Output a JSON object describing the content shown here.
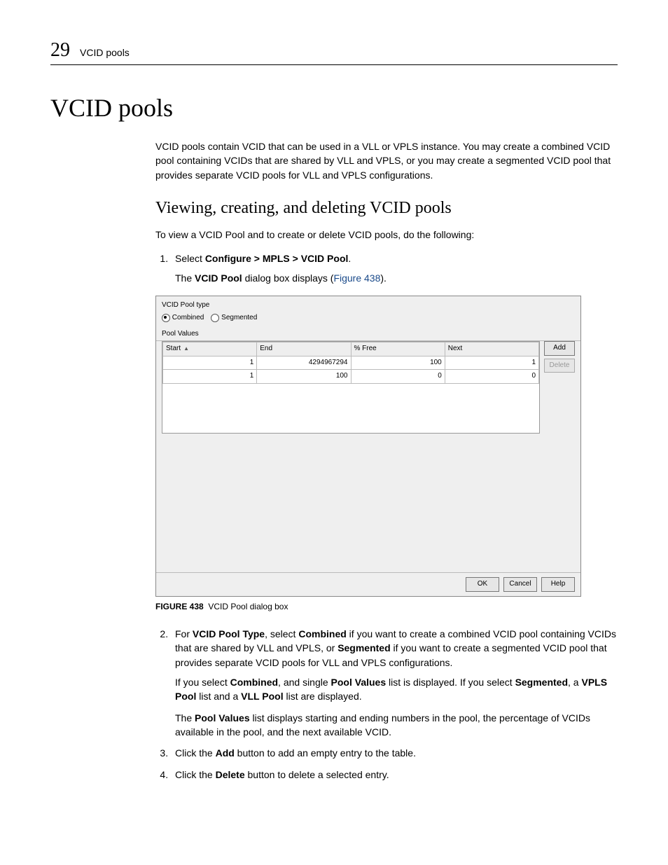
{
  "header": {
    "chapter_number": "29",
    "running_title": "VCID pools"
  },
  "h1": "VCID pools",
  "intro": "VCID pools contain VCID that can be used in a VLL or VPLS instance. You may create a combined VCID pool containing VCIDs that are shared by VLL and VPLS, or you may create a segmented VCID pool that provides separate VCID pools for VLL and VPLS configurations.",
  "h2": "Viewing, creating, and deleting VCID pools",
  "lead": "To view a VCID Pool and to create or delete VCID pools, do the following:",
  "step1": {
    "prefix": "Select ",
    "path": "Configure > MPLS > VCID Pool",
    "suffix": ".",
    "line2_a": "The ",
    "line2_b": "VCID Pool",
    "line2_c": " dialog box displays (",
    "line2_link": "Figure 438",
    "line2_d": ")."
  },
  "dialog": {
    "pool_type_label": "VCID Pool type",
    "radio_combined": "Combined",
    "radio_segmented": "Segmented",
    "pool_values_label": "Pool Values",
    "columns": {
      "start": "Start",
      "end": "End",
      "free": "% Free",
      "next": "Next"
    },
    "rows": [
      {
        "start": "1",
        "end": "4294967294",
        "free": "100",
        "next": "1"
      },
      {
        "start": "1",
        "end": "100",
        "free": "0",
        "next": "0"
      }
    ],
    "buttons": {
      "add": "Add",
      "delete": "Delete",
      "ok": "OK",
      "cancel": "Cancel",
      "help": "Help"
    }
  },
  "figure": {
    "label": "FIGURE 438",
    "caption": "VCID Pool dialog box"
  },
  "step2": {
    "p1_a": "For ",
    "p1_b": "VCID Pool Type",
    "p1_c": ", select ",
    "p1_d": "Combined",
    "p1_e": " if you want to create a combined VCID pool containing VCIDs that are shared by VLL and VPLS, or ",
    "p1_f": "Segmented",
    "p1_g": " if you want to create a segmented VCID pool that provides separate VCID pools for VLL and VPLS configurations.",
    "p2_a": "If you select ",
    "p2_b": "Combined",
    "p2_c": ", and single ",
    "p2_d": "Pool Values",
    "p2_e": " list is displayed. If you select ",
    "p2_f": "Segmented",
    "p2_g": ", a ",
    "p2_h": "VPLS Pool",
    "p2_i": " list and a ",
    "p2_j": "VLL Pool",
    "p2_k": " list are displayed.",
    "p3_a": "The ",
    "p3_b": "Pool Values",
    "p3_c": " list displays starting and ending numbers in the pool, the percentage of VCIDs available in the pool, and the next available VCID."
  },
  "step3": {
    "a": "Click the ",
    "b": "Add",
    "c": " button to add an empty entry to the table."
  },
  "step4": {
    "a": "Click the ",
    "b": "Delete",
    "c": " button to delete a selected entry."
  }
}
